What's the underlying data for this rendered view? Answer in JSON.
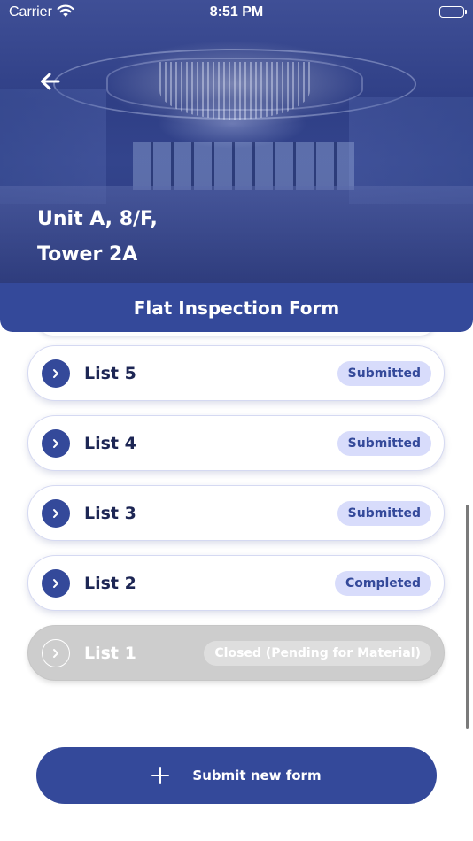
{
  "status_bar": {
    "carrier": "Carrier",
    "time": "8:51 PM"
  },
  "header": {
    "address": "Unit A, 8/F,\nTower 2A",
    "form_title": "Flat Inspection Form"
  },
  "lists": [
    {
      "name": "List 5",
      "status": "Submitted",
      "enabled": true
    },
    {
      "name": "List 4",
      "status": "Submitted",
      "enabled": true
    },
    {
      "name": "List 3",
      "status": "Submitted",
      "enabled": true
    },
    {
      "name": "List 2",
      "status": "Completed",
      "enabled": true
    },
    {
      "name": "List 1",
      "status": "Closed (Pending for Material)",
      "enabled": false
    }
  ],
  "footer": {
    "submit_label": "Submit new form"
  },
  "icons": {
    "back": "arrow-left-icon",
    "chevron": "chevron-right-icon",
    "plus": "plus-icon",
    "wifi": "wifi-icon",
    "battery": "battery-icon"
  },
  "colors": {
    "primary": "#34499a",
    "badge_bg": "#d8dcfb",
    "disabled_bg": "#cdcdcd",
    "text_dark": "#1d2654"
  }
}
